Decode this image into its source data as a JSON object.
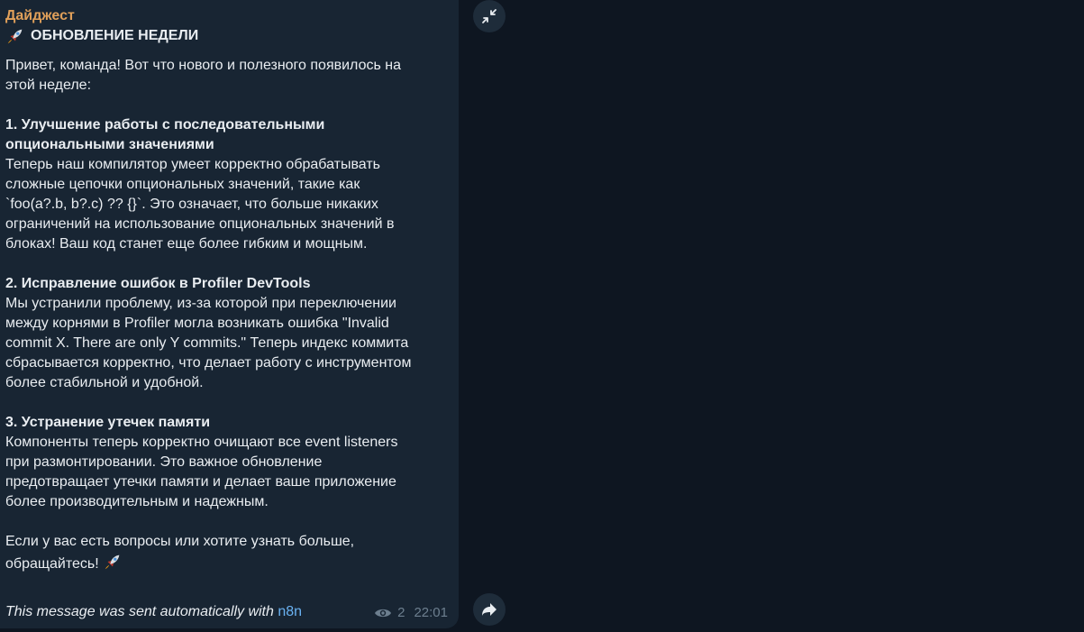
{
  "message": {
    "sender": "Дайджест",
    "title": "ОБНОВЛЕНИЕ НЕДЕЛИ",
    "intro_1": "Привет, команда! Вот что нового и полезного появилось на",
    "intro_2": "этой неделе:",
    "s1_head_1": "1. Улучшение работы с последовательными",
    "s1_head_2": "опциональными значениями",
    "s1_body_1": "Теперь наш компилятор умеет корректно обрабатывать",
    "s1_body_2": "сложные цепочки опциональных значений, такие как",
    "s1_body_3": "`foo(a?.b, b?.c) ?? {}`. Это означает, что больше никаких",
    "s1_body_4": "ограничений на использование опциональных значений в",
    "s1_body_5": "блоках! Ваш код станет еще более гибким и мощным.",
    "s2_head": "2. Исправление ошибок в Profiler DevTools",
    "s2_body_1": "Мы устранили проблему, из-за которой при переключении",
    "s2_body_2": "между корнями в Profiler могла возникать ошибка \"Invalid",
    "s2_body_3": "commit X. There are only Y commits.\" Теперь индекс коммита",
    "s2_body_4": "сбрасывается корректно, что делает работу с инструментом",
    "s2_body_5": "более стабильной и удобной.",
    "s3_head": "3. Устранение утечек памяти",
    "s3_body_1": "Компоненты теперь корректно очищают все event listeners",
    "s3_body_2": "при размонтировании. Это важное обновление",
    "s3_body_3": "предотвращает утечки памяти и делает ваше приложение",
    "s3_body_4": "более производительным и надежным.",
    "outro_1": "Если у вас есть вопросы или хотите узнать больше,",
    "outro_2": "обращайтесь!",
    "signature": "This message was sent automatically with ",
    "signature_link": "n8n",
    "views": "2",
    "time": "22:01"
  },
  "icons": {
    "emoji": "rocket-icon",
    "views": "eye-icon",
    "collapse": "collapse-icon",
    "forward": "forward-icon"
  },
  "colors": {
    "background": "#0e1621",
    "bubble": "#182533",
    "sender": "#e0a05a",
    "link": "#6ab2f2",
    "meta": "#6d7f8f"
  }
}
